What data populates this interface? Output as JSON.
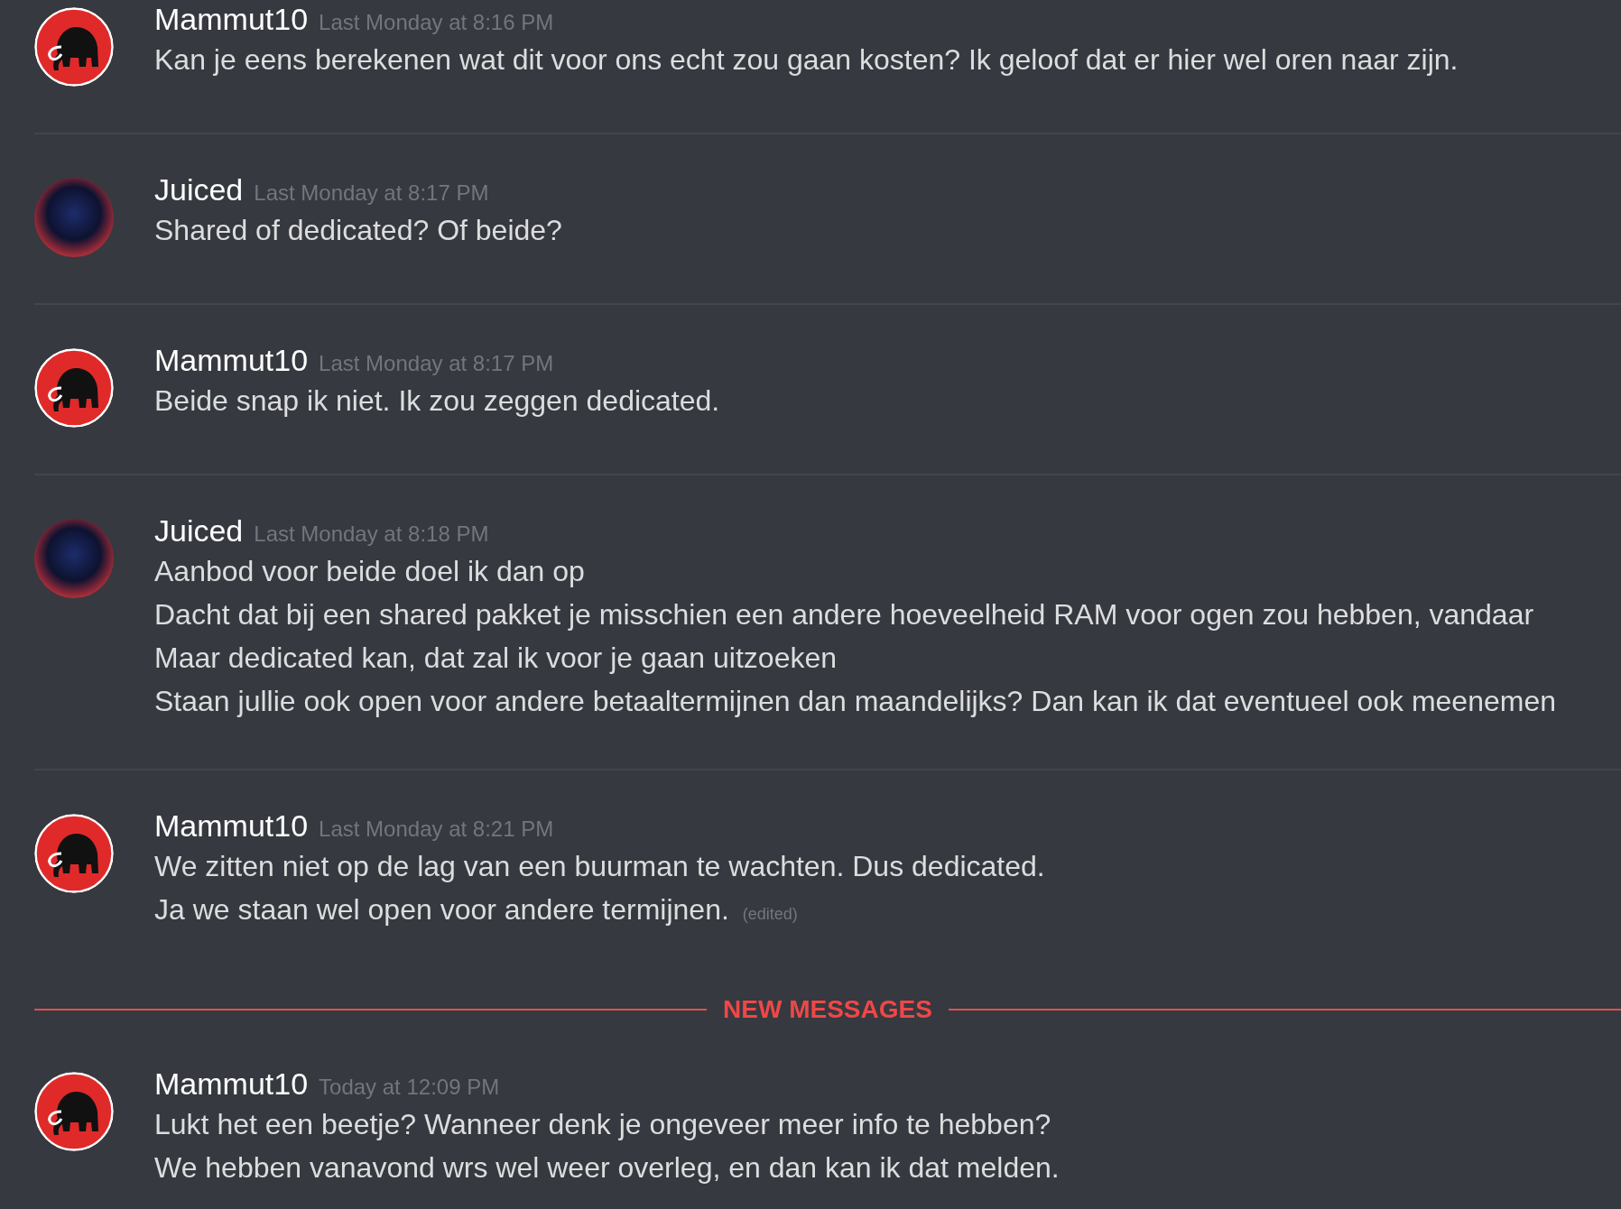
{
  "items": [
    {
      "kind": "message",
      "avatar": {
        "kind": "mammoth"
      },
      "author": "Mammut10",
      "timestamp": "Last Monday at 8:16 PM",
      "lines": [
        {
          "text": "Kan je eens berekenen wat dit voor ons echt zou gaan kosten? Ik geloof dat er hier wel oren naar zijn."
        }
      ]
    },
    {
      "kind": "message",
      "avatar": {
        "kind": "photo"
      },
      "author": "Juiced",
      "timestamp": "Last Monday at 8:17 PM",
      "lines": [
        {
          "text": "Shared of dedicated? Of beide?"
        }
      ]
    },
    {
      "kind": "message",
      "avatar": {
        "kind": "mammoth"
      },
      "author": "Mammut10",
      "timestamp": "Last Monday at 8:17 PM",
      "lines": [
        {
          "text": "Beide snap ik niet. Ik zou zeggen dedicated."
        }
      ]
    },
    {
      "kind": "message",
      "avatar": {
        "kind": "photo"
      },
      "author": "Juiced",
      "timestamp": "Last Monday at 8:18 PM",
      "lines": [
        {
          "text": "Aanbod voor beide doel ik dan op"
        },
        {
          "text": "Dacht dat bij een shared pakket je misschien een andere hoeveelheid RAM voor ogen zou hebben, vandaar"
        },
        {
          "text": "Maar dedicated kan, dat zal ik voor je gaan uitzoeken"
        },
        {
          "text": "Staan jullie ook open voor andere betaaltermijnen dan maandelijks? Dan kan ik dat eventueel ook meenemen"
        }
      ]
    },
    {
      "kind": "message",
      "avatar": {
        "kind": "mammoth"
      },
      "author": "Mammut10",
      "timestamp": "Last Monday at 8:21 PM",
      "lines": [
        {
          "text": "We zitten niet op de lag van een buurman te wachten. Dus dedicated."
        },
        {
          "text": "Ja we staan wel open voor andere termijnen.",
          "edited": "(edited)"
        }
      ]
    },
    {
      "kind": "divider",
      "label": "NEW MESSAGES"
    },
    {
      "kind": "message",
      "avatar": {
        "kind": "mammoth"
      },
      "author": "Mammut10",
      "timestamp": "Today at 12:09 PM",
      "lines": [
        {
          "text": "Lukt het een beetje? Wanneer denk je ongeveer meer info te hebben?"
        },
        {
          "text": "We hebben vanavond wrs wel weer overleg, en dan kan ik dat melden."
        }
      ]
    }
  ]
}
